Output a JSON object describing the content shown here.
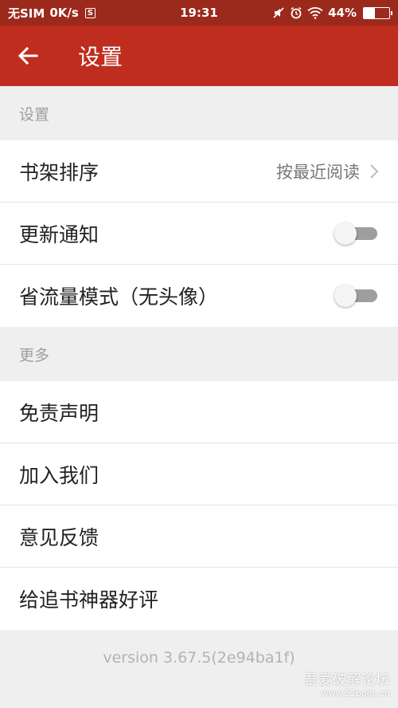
{
  "status_bar": {
    "sim_text": "无SIM",
    "speed": "0K/s",
    "sim_icon_label": "S",
    "time": "19:31",
    "battery_percent": "44%",
    "battery_level": 0.44,
    "icons": [
      "silent-icon",
      "alarm-icon",
      "wifi-icon",
      "battery-icon"
    ]
  },
  "app_bar": {
    "title": "设置",
    "color": "#bf2d1f"
  },
  "sections": {
    "settings": {
      "header": "设置",
      "items": {
        "shelf_sort": {
          "label": "书架排序",
          "value": "按最近阅读"
        },
        "update_notify": {
          "label": "更新通知",
          "toggle_on": false
        },
        "data_saver": {
          "label": "省流量模式（无头像）",
          "toggle_on": false
        }
      }
    },
    "more": {
      "header": "更多",
      "items": {
        "disclaimer": {
          "label": "免责声明"
        },
        "join_us": {
          "label": "加入我们"
        },
        "feedback": {
          "label": "意见反馈"
        },
        "rate": {
          "label": "给追书神器好评"
        }
      }
    }
  },
  "footer": {
    "version": "version 3.67.5(2e94ba1f)"
  },
  "watermark": {
    "name": "吾爱破解论坛",
    "url": "www.52pojie.cn"
  }
}
